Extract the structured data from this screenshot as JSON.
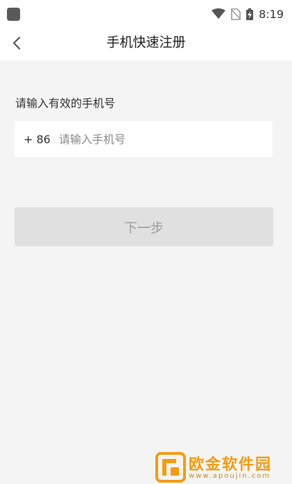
{
  "status_bar": {
    "time": "8:19",
    "icons": [
      "app-notification-icon",
      "wifi-icon",
      "no-sim-icon",
      "battery-charging-icon"
    ]
  },
  "header": {
    "title": "手机快速注册",
    "back_icon": "chevron-left-icon"
  },
  "form": {
    "prompt": "请输入有效的手机号",
    "country_code": "+ 86",
    "phone_value": "",
    "phone_placeholder": "请输入手机号"
  },
  "actions": {
    "next_label": "下一步"
  },
  "watermark": {
    "name": "欧金软件园",
    "url": "www.apoujin.com"
  },
  "colors": {
    "background": "#f4f4f4",
    "surface": "#ffffff",
    "button_disabled_bg": "#e0e0e0",
    "button_disabled_text": "#9c9c9c",
    "watermark_orange": "#f39c12"
  }
}
